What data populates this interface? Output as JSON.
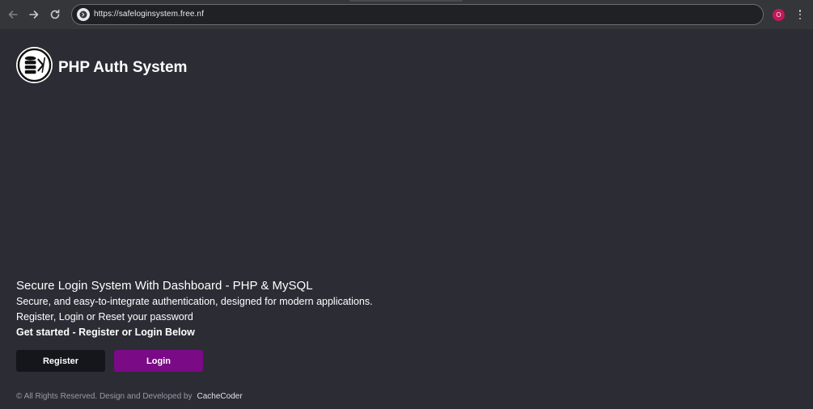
{
  "browser": {
    "url": "https://safeloginsystem.free.nf",
    "profile_initial": "O",
    "back_icon": "arrow-left-icon",
    "forward_icon": "arrow-right-icon",
    "reload_icon": "reload-icon",
    "menu_icon": "kebab-menu-icon"
  },
  "brand": {
    "title": "PHP Auth System",
    "logo_icon": "database-code-icon"
  },
  "hero": {
    "heading": "Secure Login System With Dashboard - PHP & MySQL",
    "line1": "Secure, and easy-to-integrate authentication, designed for modern applications.",
    "line2": "Register, Login or Reset your password",
    "line3": "Get started - Register or Login Below"
  },
  "actions": {
    "register_label": "Register",
    "login_label": "Login",
    "register_color": "#15161c",
    "login_color": "#7a0a86"
  },
  "footer": {
    "text": "© All Rights Reserved. Design and Developed by",
    "author": "CacheCoder"
  },
  "colors": {
    "page_bg": "#2c2c35",
    "toolbar_bg": "#35363a"
  }
}
